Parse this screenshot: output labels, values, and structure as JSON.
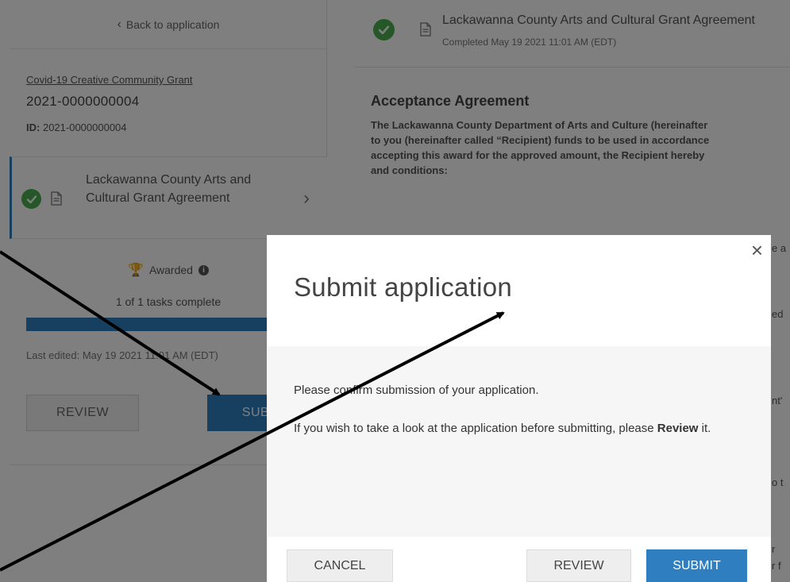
{
  "sidebar": {
    "back_label": "Back to application",
    "grant_name": "Covid-19 Creative Community Grant",
    "grant_number": "2021-0000000004",
    "id_label": "ID:",
    "id_value": "2021-0000000004",
    "task": {
      "title": "Lackawanna County Arts and Cultural Grant Agreement",
      "status": "completed"
    },
    "awarded_label": "Awarded",
    "tasks_complete": "1 of 1 tasks complete",
    "progress_fraction": 1.0,
    "last_edited": "Last edited: May 19 2021 11:01 AM (EDT)",
    "review_label": "REVIEW",
    "submit_label": "SUBMIT"
  },
  "document": {
    "title": "Lackawanna County Arts and Cultural Grant Agreement",
    "completed": "Completed May 19 2021 11:01 AM (EDT)",
    "heading": "Acceptance Agreement",
    "body_lines": [
      "The Lackawanna County Department of Arts and Culture (hereinafter",
      "to you (hereinafter called “Recipient) funds to be used in accordance",
      "accepting this award for the approved amount, the Recipient hereby",
      "and conditions:"
    ],
    "peek_lines": [
      "e a",
      "ed",
      "nt'",
      "o t",
      "r",
      "r f"
    ]
  },
  "modal": {
    "title": "Submit application",
    "message": "Please confirm submission of your application.",
    "review_prompt_start": "If you wish to take a look at the application before submitting, please ",
    "review_prompt_bold": "Review",
    "review_prompt_end": " it.",
    "cancel_label": "CANCEL",
    "review_label": "REVIEW",
    "submit_label": "SUBMIT"
  },
  "colors": {
    "accent": "#2f7fc0",
    "success": "#4caf50",
    "overlay": "rgba(0,0,0,0.5)"
  },
  "icons": [
    "chevron-left-icon",
    "check-circle-icon",
    "document-icon",
    "chevron-right-icon",
    "trophy-icon",
    "info-icon",
    "close-icon"
  ]
}
